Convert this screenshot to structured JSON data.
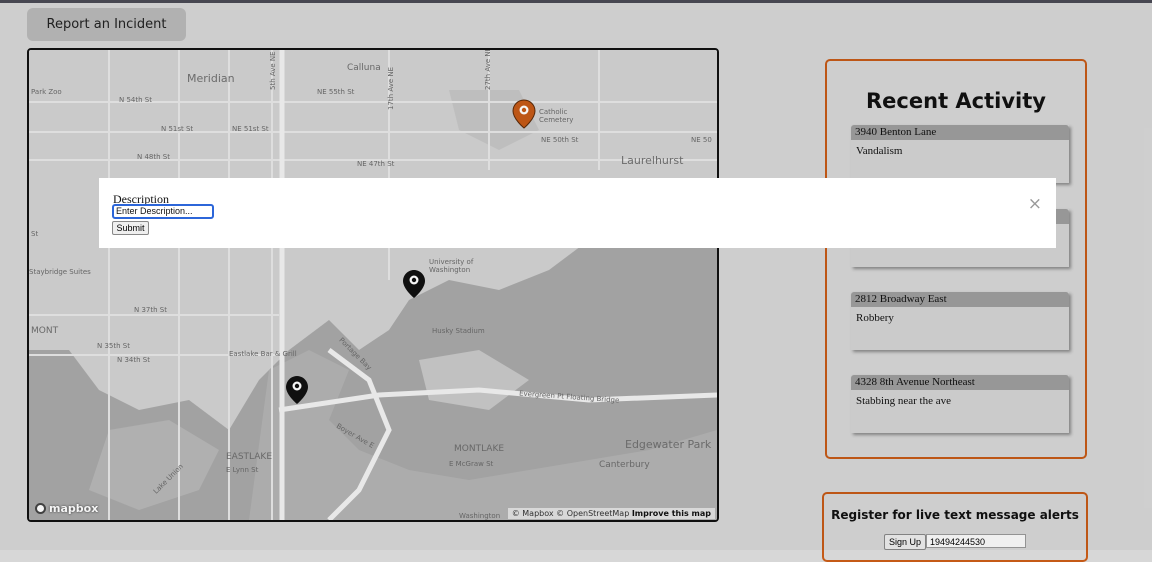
{
  "toolbar": {
    "report_label": "Report an Incident"
  },
  "map": {
    "labels": {
      "meridian": "Meridian",
      "n54": "N 54th St",
      "park_zoo": "Park Zoo",
      "n51": "N 51st St",
      "ne51": "NE 51st St",
      "n48": "N 48th St",
      "ne47": "NE 47th St",
      "calluna": "Calluna",
      "ne55": "NE 55th St",
      "catholic": "Catholic\nCemetery",
      "ne50": "NE 50th St",
      "ne50b": "NE 50",
      "laurelhurst": "Laurelhurst",
      "staybridge": "Staybridge Suites",
      "uw": "University of\nWashington",
      "n37": "N 37th St",
      "n35": "N 35th St",
      "n34": "N 34th St",
      "mont": "MONT",
      "eastlake_bar": "Eastlake Bar & Grill",
      "portage": "Portage Bay",
      "husky": "Husky Stadium",
      "evergreen": "Evergreen Pt Floating Bridge",
      "edgewater": "Edgewater Park",
      "boyer": "Boyer Ave E",
      "montlake": "MONTLAKE",
      "mcgraw": "E McGraw St",
      "canterbury": "Canterbury",
      "eastlake": "EASTLAKE",
      "lynn": "E Lynn St",
      "lake_union": "Lake Union",
      "washington": "Washington",
      "st": "St",
      "fifth_ave": "5th Ave NE",
      "seventeenth": "17th Ave NE",
      "twentyseventh": "27th Ave NE"
    },
    "logo": "mapbox",
    "attribution": "© Mapbox © OpenStreetMap",
    "improve": "Improve this map"
  },
  "activity": {
    "title": "Recent Activity",
    "items": [
      {
        "address": "3940 Benton Lane",
        "description": "Vandalism"
      },
      {
        "address": "2812 Broadway East",
        "description": "Robbery"
      },
      {
        "address": "4328 8th Avenue Northeast",
        "description": "Stabbing near the ave"
      }
    ]
  },
  "register": {
    "title": "Register for live text message alerts",
    "button": "Sign Up",
    "phone": "19494244530"
  },
  "modal": {
    "label": "Description",
    "input_value": "Enter Description...",
    "submit": "Submit",
    "close": "×"
  },
  "colors": {
    "accent": "#c55a17",
    "pin_orange": "#c55a17",
    "pin_black": "#111111",
    "focus": "#2c66d9"
  }
}
